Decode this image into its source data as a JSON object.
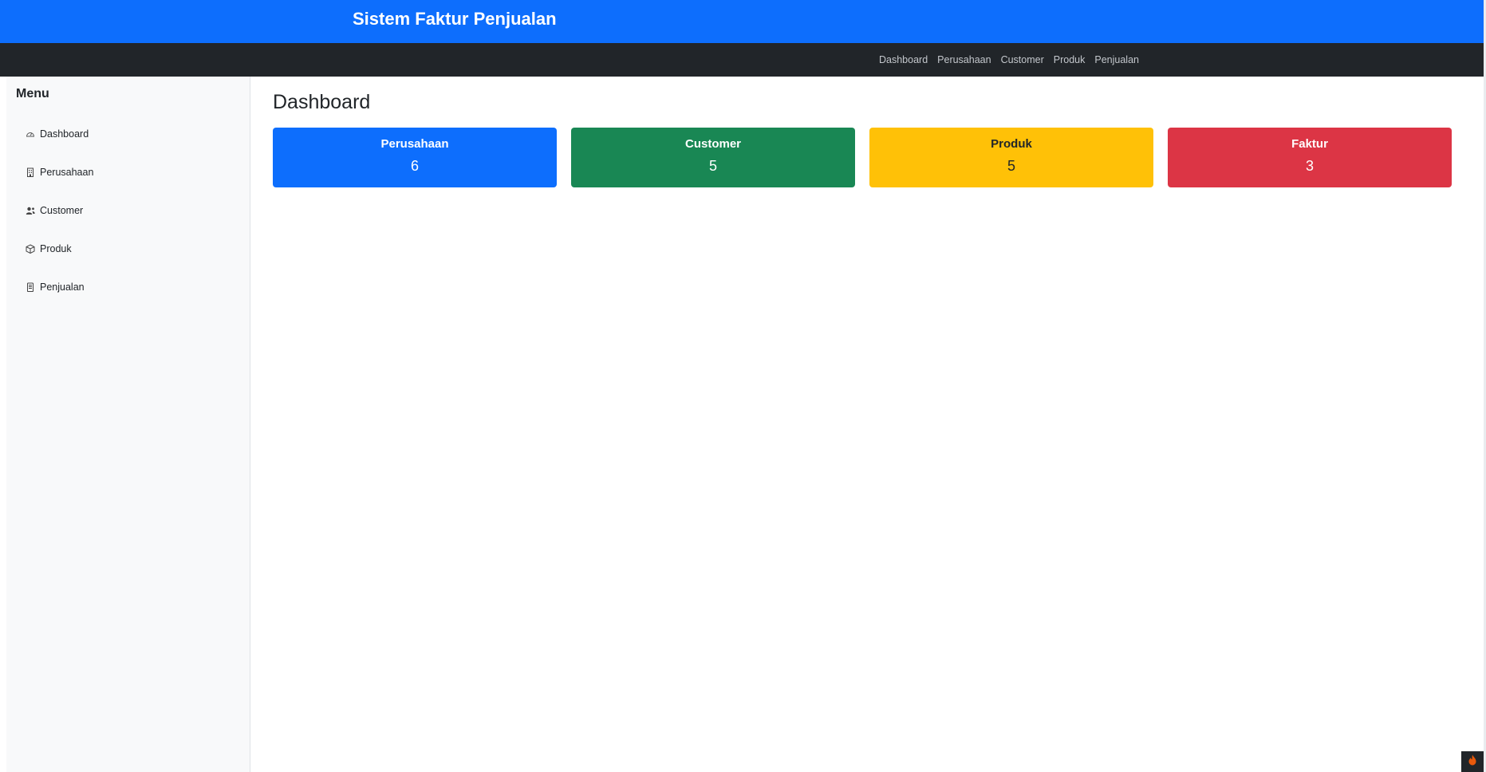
{
  "header": {
    "brand": "Sistem Faktur Penjualan",
    "bg_color": "#0d6efd"
  },
  "navbar": {
    "bg_color": "#212529",
    "links": [
      "Dashboard",
      "Perusahaan",
      "Customer",
      "Produk",
      "Penjualan"
    ]
  },
  "sidebar": {
    "title": "Menu",
    "items": [
      {
        "label": "Dashboard",
        "icon": "speedometer-icon"
      },
      {
        "label": "Perusahaan",
        "icon": "building-icon"
      },
      {
        "label": "Customer",
        "icon": "people-icon"
      },
      {
        "label": "Produk",
        "icon": "box-icon"
      },
      {
        "label": "Penjualan",
        "icon": "receipt-icon"
      }
    ]
  },
  "main": {
    "page_title": "Dashboard",
    "cards": [
      {
        "title": "Perusahaan",
        "value": "6",
        "color": "#0d6efd",
        "text_color": "#ffffff"
      },
      {
        "title": "Customer",
        "value": "5",
        "color": "#198754",
        "text_color": "#ffffff"
      },
      {
        "title": "Produk",
        "value": "5",
        "color": "#ffc107",
        "text_color": "#212529"
      },
      {
        "title": "Faktur",
        "value": "3",
        "color": "#dc3545",
        "text_color": "#ffffff"
      }
    ]
  },
  "corner_widget": {
    "icon": "fire-icon"
  }
}
